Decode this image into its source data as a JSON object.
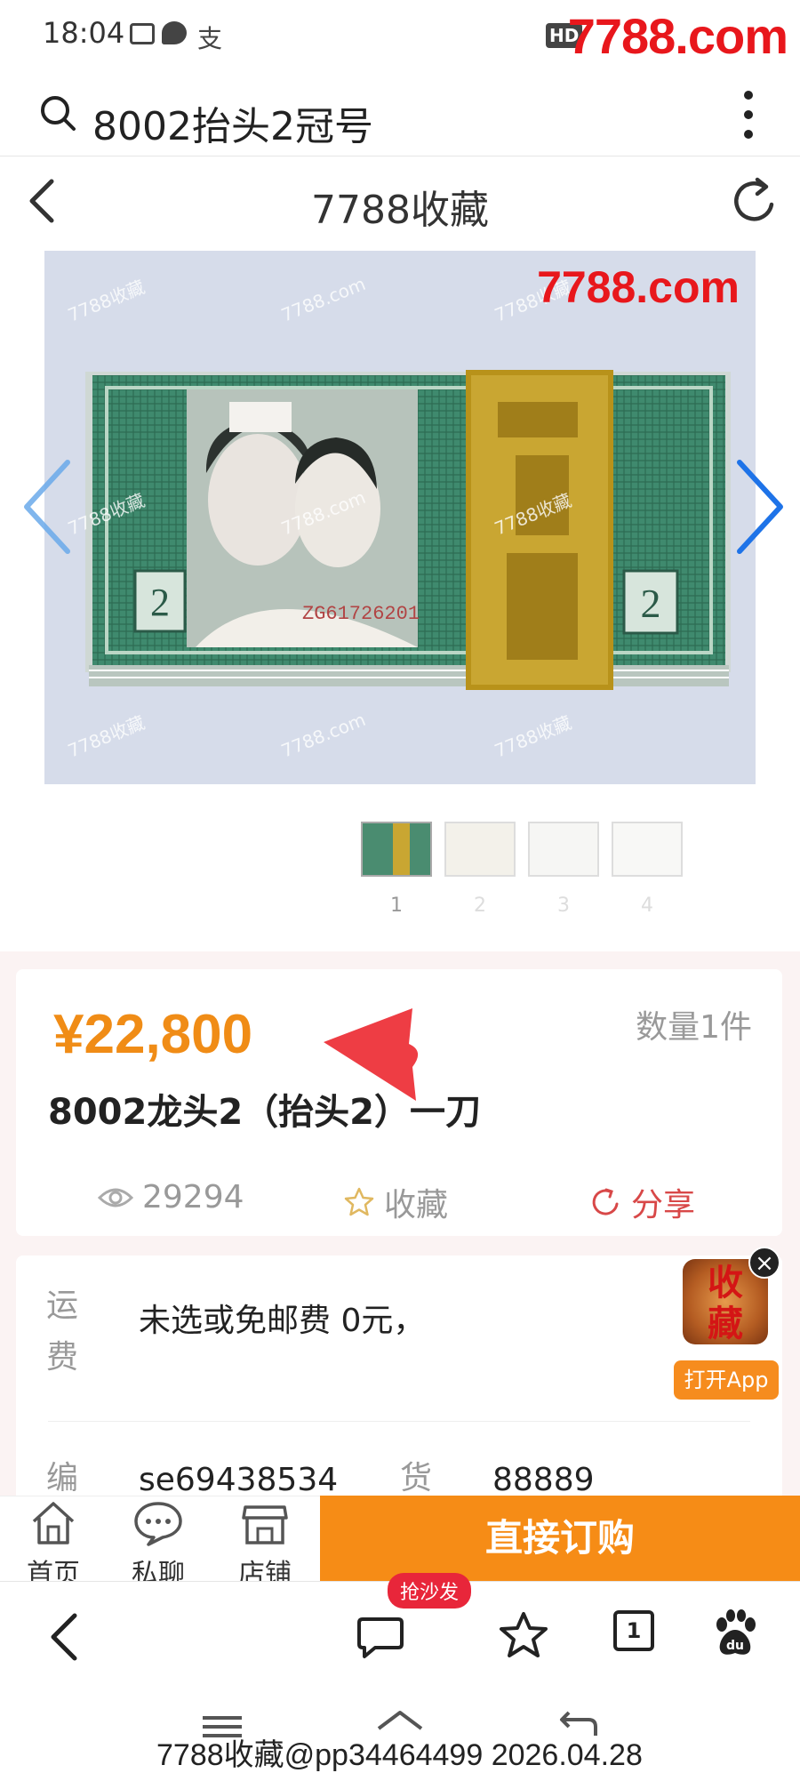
{
  "status_bar": {
    "time": "18:04",
    "brand_watermark": "7788.com",
    "network_label": "HD"
  },
  "search": {
    "query": "8002抬头2冠号"
  },
  "nav": {
    "title": "7788收藏"
  },
  "photo": {
    "brand": "7788.com",
    "watermark_site": "7788.com",
    "watermark_cn": "7788收藏",
    "serial": "ZG61726201",
    "denomination": "2"
  },
  "thumbnails": [
    {
      "num": "1",
      "selected": true
    },
    {
      "num": "2",
      "selected": false
    },
    {
      "num": "3",
      "selected": false
    },
    {
      "num": "4",
      "selected": false
    }
  ],
  "product": {
    "price": "¥22,800",
    "quantity": "数量1件",
    "title": "8002龙头2（抬头2）一刀",
    "views": "29294",
    "favorite_label": "收藏",
    "share_label": "分享"
  },
  "shipping": {
    "label": "运费",
    "value": "未选或免邮费 0元，"
  },
  "item_info": {
    "code_label": "编",
    "code_value": "se69438534",
    "goods_label": "货",
    "goods_value": "88889"
  },
  "app_badge": {
    "icon_text_1": "收",
    "icon_text_2": "藏",
    "open_label": "打开App",
    "close": "×"
  },
  "action_bar": {
    "home": "首页",
    "chat": "私聊",
    "shop": "店铺",
    "buy": "直接订购"
  },
  "browser_bar": {
    "bubble_badge": "抢沙发",
    "tab_count": "1"
  },
  "footer_watermark": "7788收藏@pp34464499 2026.04.28",
  "colors": {
    "price": "#f08c16",
    "buy": "#f68c16",
    "share": "#d84848",
    "brand": "#e8171c",
    "band": "#fbf3f3"
  }
}
